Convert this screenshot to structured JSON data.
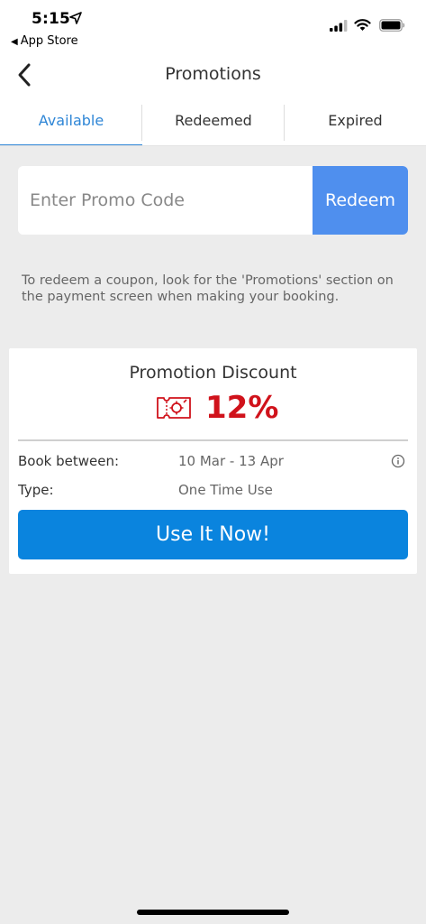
{
  "status_bar": {
    "time": "5:15",
    "back_app": "App Store"
  },
  "nav": {
    "title": "Promotions"
  },
  "tabs": [
    {
      "label": "Available",
      "active": true
    },
    {
      "label": "Redeemed",
      "active": false
    },
    {
      "label": "Expired",
      "active": false
    }
  ],
  "promo": {
    "placeholder": "Enter Promo Code",
    "value": "",
    "redeem_label": "Redeem"
  },
  "info_text": "To redeem a coupon, look for the 'Promotions' section on the payment screen when making your booking.",
  "promotion_card": {
    "title": "Promotion Discount",
    "discount": "12%",
    "book_between_label": "Book between:",
    "book_between_value": "10 Mar - 13 Apr",
    "type_label": "Type:",
    "type_value": "One Time Use",
    "button_label": "Use It Now!"
  },
  "colors": {
    "accent_tab": "#2f86d6",
    "redeem_button": "#4f8fee",
    "use_button": "#0a84de",
    "discount_red": "#d0121b",
    "background": "#ececec"
  },
  "icons": {
    "status": [
      "location-arrow-icon",
      "signal-icon",
      "wifi-icon",
      "battery-icon"
    ],
    "nav": "chevron-left-icon",
    "card": [
      "coupon-icon",
      "info-icon"
    ]
  }
}
